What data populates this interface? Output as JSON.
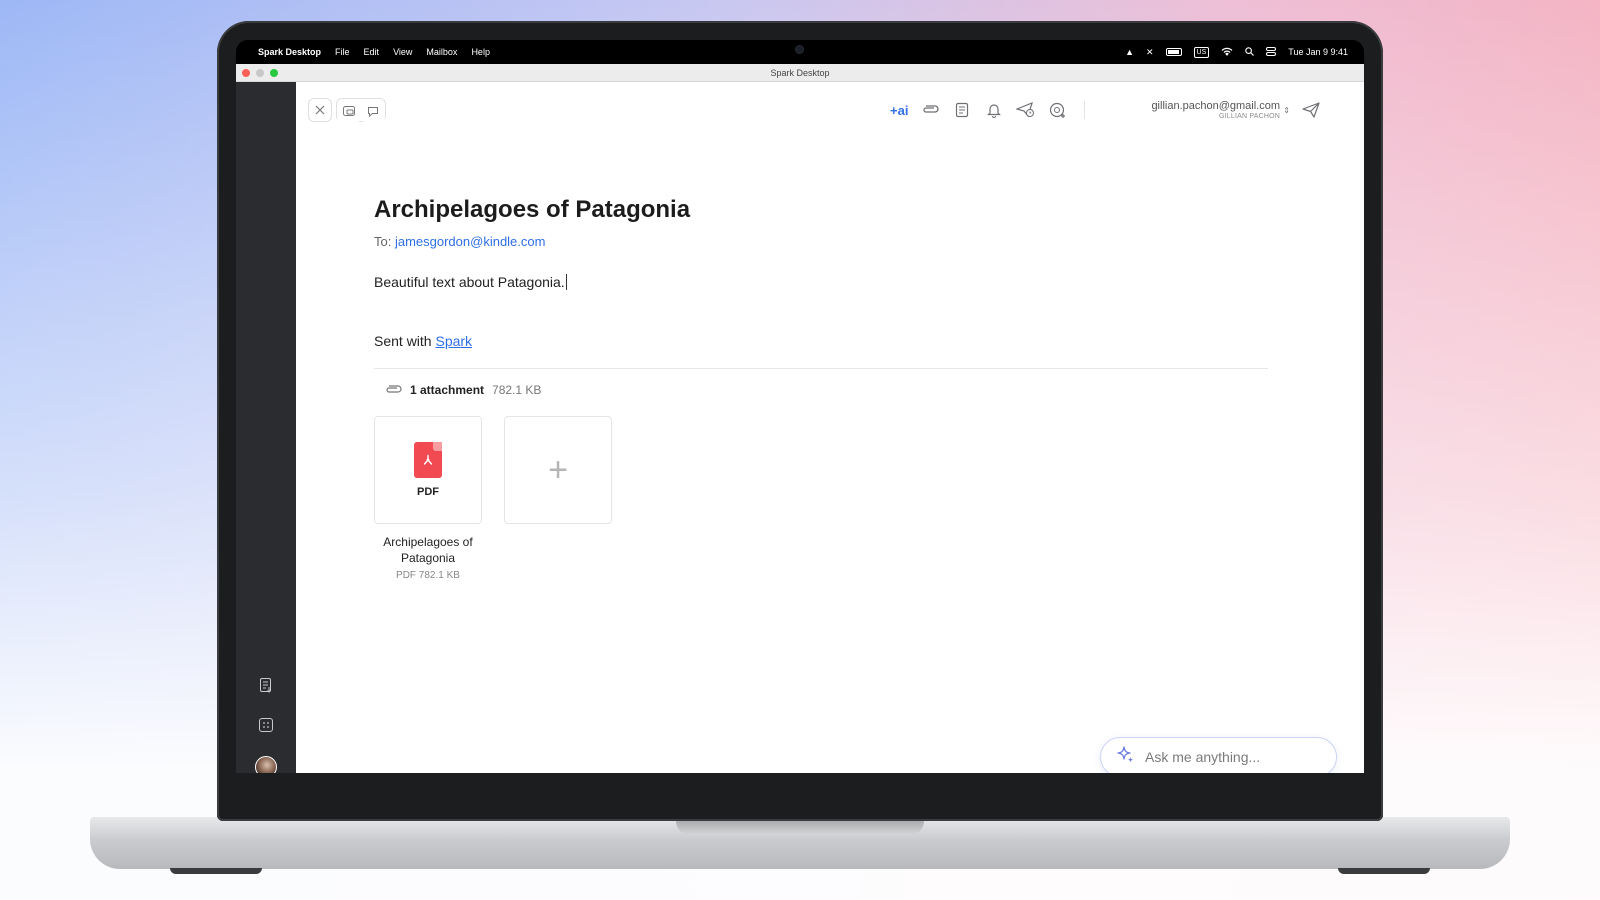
{
  "menubar": {
    "app_name": "Spark Desktop",
    "items": [
      "File",
      "Edit",
      "View",
      "Mailbox",
      "Help"
    ],
    "input_source": "US",
    "clock": "Tue Jan 9  9:41"
  },
  "window": {
    "title": "Spark Desktop"
  },
  "toolbar": {
    "ai_label": "+ai",
    "sender_email": "gillian.pachon@gmail.com",
    "sender_name": "GILLIAN PACHON"
  },
  "email": {
    "subject": "Archipelagoes of Patagonia",
    "to_label": "To:",
    "to_address": "jamesgordon@kindle.com",
    "body": "Beautiful text about Patagonia.",
    "signature_prefix": "Sent with",
    "signature_link": "Spark"
  },
  "attachments": {
    "count_label": "1 attachment",
    "total_size": "782.1 KB",
    "items": [
      {
        "type_label": "PDF",
        "name": "Archipelagoes of Patagonia",
        "meta": "PDF 782.1 KB"
      }
    ]
  },
  "assistant": {
    "placeholder": "Ask me anything..."
  },
  "colors": {
    "accent": "#2f6fe6",
    "pdf": "#f24a52",
    "sidebar": "#2b2c2f"
  }
}
